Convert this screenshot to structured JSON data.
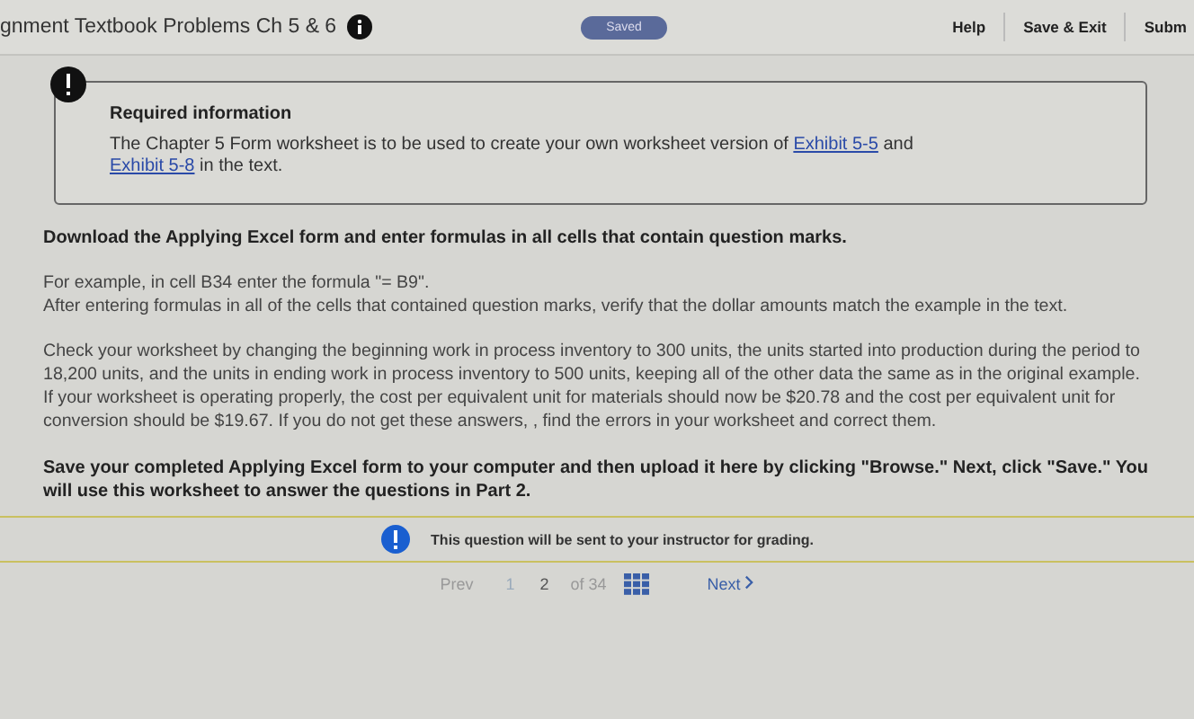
{
  "header": {
    "title": "gnment Textbook Problems Ch 5 & 6",
    "status": "Saved",
    "actions": [
      "Help",
      "Save & Exit",
      "Subm"
    ]
  },
  "notice": {
    "heading": "Required information",
    "text_parts": [
      {
        "kind": "text",
        "text": "The Chapter 5 Form worksheet is to be used to create your own worksheet version of "
      },
      {
        "kind": "link",
        "text": "Exhibit 5-5"
      },
      {
        "kind": "text",
        "text": " and "
      },
      {
        "kind": "link",
        "text": "Exhibit 5-8"
      },
      {
        "kind": "text",
        "text": " in the text."
      }
    ]
  },
  "instructions": [
    {
      "kind": "bold",
      "text": "Download the Applying Excel form and enter formulas in all cells that contain question marks."
    },
    {
      "kind": "lines",
      "lines": [
        "For example, in cell B34 enter the formula \"= B9\".",
        "After entering formulas in all of the cells that contained question marks, verify that the dollar amounts match the example in the text."
      ]
    },
    {
      "kind": "plain",
      "text": "Check your worksheet by changing the beginning work in process inventory to 300 units, the units started into production during the period to 18,200 units, and the units in ending work in process inventory to 500 units, keeping all of the other data the same as in the original example. If your worksheet is operating properly, the cost per equivalent unit for materials should now be $20.78 and the cost per equivalent unit for conversion should be $19.67. If you do not get these answers, , find the errors in your worksheet and correct them."
    },
    {
      "kind": "bold",
      "text": "Save your completed Applying Excel form to your computer and then upload it here by clicking \"Browse.\" Next, click \"Save.\" You will use this worksheet to answer the questions in Part 2."
    }
  ],
  "grading_note": "This question will be sent to your instructor for grading.",
  "pager": {
    "prev": "Prev",
    "pages": [
      {
        "label": "1",
        "selected": false
      },
      {
        "label": "2",
        "selected": true
      }
    ],
    "total": "of 34",
    "next": "Next"
  }
}
